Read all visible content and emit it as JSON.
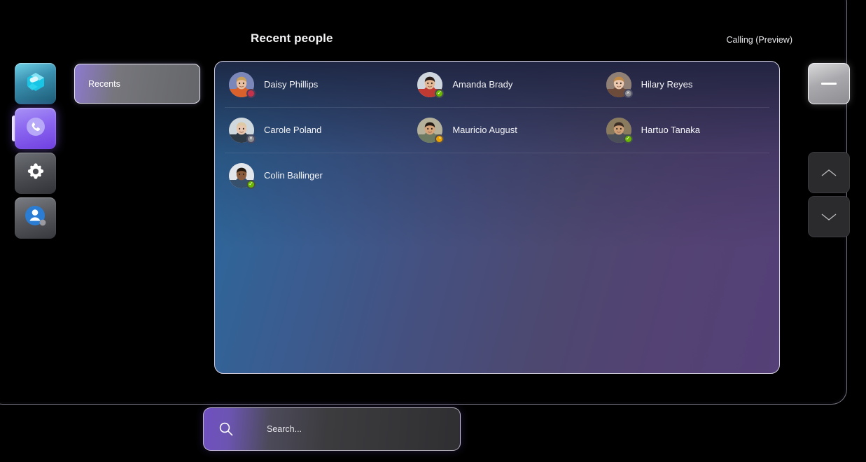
{
  "header": {
    "title": "Recent people",
    "mode_label": "Calling (Preview)"
  },
  "sidebar": {
    "items": [
      {
        "id": "teams",
        "label": "Teams",
        "icon": "teams-logo-icon",
        "active": false
      },
      {
        "id": "calls",
        "label": "Calls",
        "icon": "phone-icon",
        "active": true
      },
      {
        "id": "settings",
        "label": "Settings",
        "icon": "gear-icon",
        "active": false
      },
      {
        "id": "people",
        "label": "People",
        "icon": "person-icon",
        "active": false
      }
    ]
  },
  "tabs": [
    {
      "id": "recents",
      "label": "Recents",
      "selected": true
    }
  ],
  "people": {
    "rows": [
      [
        {
          "name": "Daisy Phillips",
          "presence": "busy",
          "presence_label": "Busy"
        },
        {
          "name": "Amanda Brady",
          "presence": "available",
          "presence_label": "Available"
        },
        {
          "name": "Hilary Reyes",
          "presence": "offline",
          "presence_label": "Offline"
        }
      ],
      [
        {
          "name": "Carole Poland",
          "presence": "offline",
          "presence_label": "Offline"
        },
        {
          "name": "Mauricio August",
          "presence": "away",
          "presence_label": "Away"
        },
        {
          "name": "Hartuo Tanaka",
          "presence": "available",
          "presence_label": "Available"
        }
      ],
      [
        {
          "name": "Colin Ballinger",
          "presence": "available",
          "presence_label": "Available"
        }
      ]
    ]
  },
  "controls": {
    "minimize_label": "—",
    "scroll_up_label": "Scroll up",
    "scroll_down_label": "Scroll down"
  },
  "search": {
    "placeholder": "Search...",
    "value": ""
  },
  "colors": {
    "accent_purple": "#8b66f0",
    "panel_blue": "#2a6a9e",
    "panel_purple": "#554077",
    "presence_available": "#6bb700",
    "presence_busy": "#c4314b",
    "presence_away": "#eaa300",
    "presence_offline": "#8a8a8f"
  }
}
